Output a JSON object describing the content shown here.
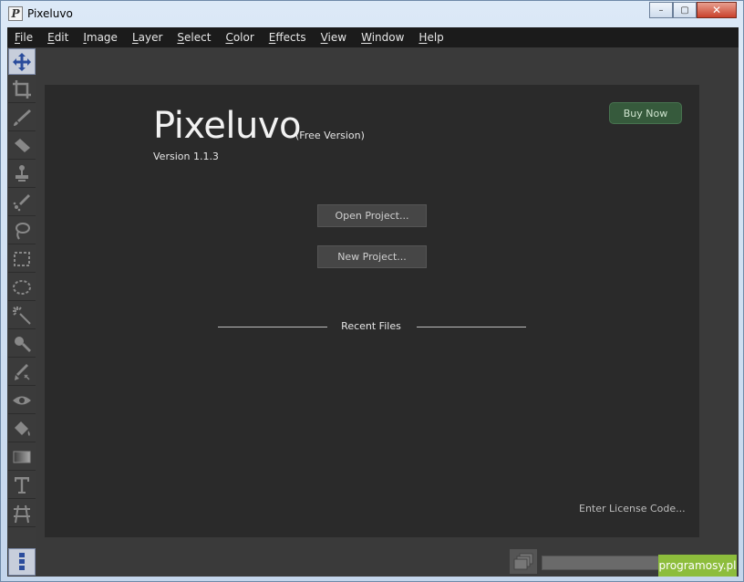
{
  "window": {
    "title": "Pixeluvo",
    "app_icon_letter": "P",
    "minimize_symbol": "–",
    "maximize_symbol": "▢",
    "close_symbol": "✕"
  },
  "menu": {
    "items": [
      "File",
      "Edit",
      "Image",
      "Layer",
      "Select",
      "Color",
      "Effects",
      "View",
      "Window",
      "Help"
    ]
  },
  "tools": [
    {
      "icon": "move-icon",
      "active": true
    },
    {
      "icon": "crop-icon"
    },
    {
      "icon": "brush-icon"
    },
    {
      "icon": "eraser-icon"
    },
    {
      "icon": "clone-stamp-icon"
    },
    {
      "icon": "smudge-icon"
    },
    {
      "icon": "lasso-icon"
    },
    {
      "icon": "rect-select-icon"
    },
    {
      "icon": "ellipse-select-icon"
    },
    {
      "icon": "magic-wand-icon"
    },
    {
      "icon": "dodge-icon"
    },
    {
      "icon": "burn-icon"
    },
    {
      "icon": "red-eye-icon"
    },
    {
      "icon": "paint-bucket-icon"
    },
    {
      "icon": "gradient-icon"
    },
    {
      "icon": "text-icon"
    },
    {
      "icon": "perspective-icon"
    }
  ],
  "welcome": {
    "brand": "Pixeluvo",
    "edition": "(Free Version)",
    "version": "Version 1.1.3",
    "buy_label": "Buy Now",
    "open_label": "Open Project...",
    "new_label": "New Project...",
    "recent_label": "Recent Files",
    "license_label": "Enter License Code..."
  },
  "status": {
    "progress_fraction": 0.0
  },
  "watermark": "programosy.pl",
  "colors": {
    "background": "#2b2b2b",
    "panel": "#2a2a2a",
    "buy_button": "#365a3c",
    "active_tool": "#c7cedb"
  }
}
